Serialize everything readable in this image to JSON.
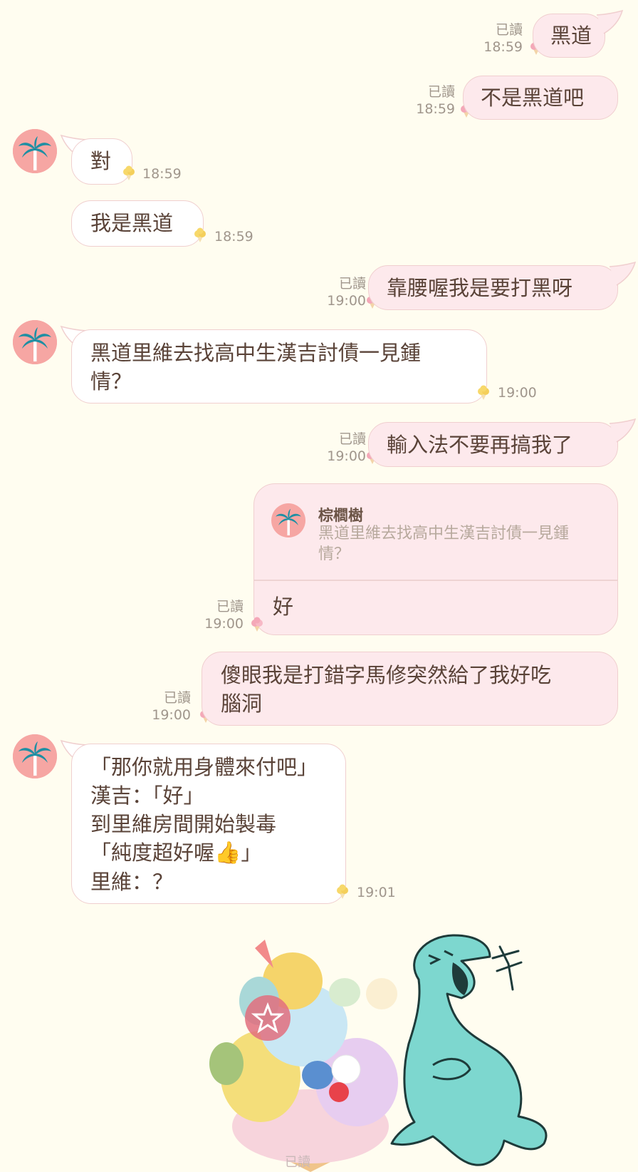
{
  "colors": {
    "background": "#fffdf0",
    "outgoing_bubble": "#fde9ec",
    "incoming_bubble": "#ffffff",
    "bubble_border": "#f0cfcf",
    "text": "#5a4338",
    "meta_text": "#a0968c",
    "avatar_bg": "#f6a6a3",
    "palm": "#1f8fa3"
  },
  "contact": {
    "name": "棕櫚樹",
    "avatar_icon": "palm-tree-icon"
  },
  "messages": [
    {
      "dir": "out",
      "text": "黑道",
      "read": "已讀",
      "time": "18:59"
    },
    {
      "dir": "out",
      "text": "不是黑道吧",
      "read": "已讀",
      "time": "18:59"
    },
    {
      "dir": "in",
      "text": "對",
      "time": "18:59"
    },
    {
      "dir": "in",
      "text": "我是黑道",
      "time": "18:59"
    },
    {
      "dir": "out",
      "text": "靠腰喔我是要打黑呀",
      "read": "已讀",
      "time": "19:00"
    },
    {
      "dir": "in",
      "lines": [
        "黑道里維去找高中生漢吉討債一見鍾",
        "情？"
      ],
      "time": "19:00"
    },
    {
      "dir": "out",
      "text": "輸入法不要再搞我了",
      "read": "已讀",
      "time": "19:00"
    },
    {
      "dir": "out",
      "reply": {
        "name": "棕櫚樹",
        "lines": [
          "黑道里維去找高中生漢吉討債一見鍾",
          "情？"
        ]
      },
      "text": "好",
      "read": "已讀",
      "time": "19:00"
    },
    {
      "dir": "out",
      "lines": [
        "傻眼我是打錯字馬修突然給了我好吃",
        "腦洞"
      ],
      "read": "已讀",
      "time": "19:00"
    },
    {
      "dir": "in",
      "lines": [
        "「那你就用身體來付吧」",
        "漢吉：「好」",
        "到里維房間開始製毒",
        "「純度超好喔",
        "」",
        "里維：？"
      ],
      "emoji": "👍",
      "time": "19:01"
    },
    {
      "dir": "out",
      "sticker": "sumikko-icecream-sticker",
      "read": "已讀"
    },
    {
      "dir": "out",
      "sticker": "laughing-dinosaur-sticker"
    }
  ]
}
